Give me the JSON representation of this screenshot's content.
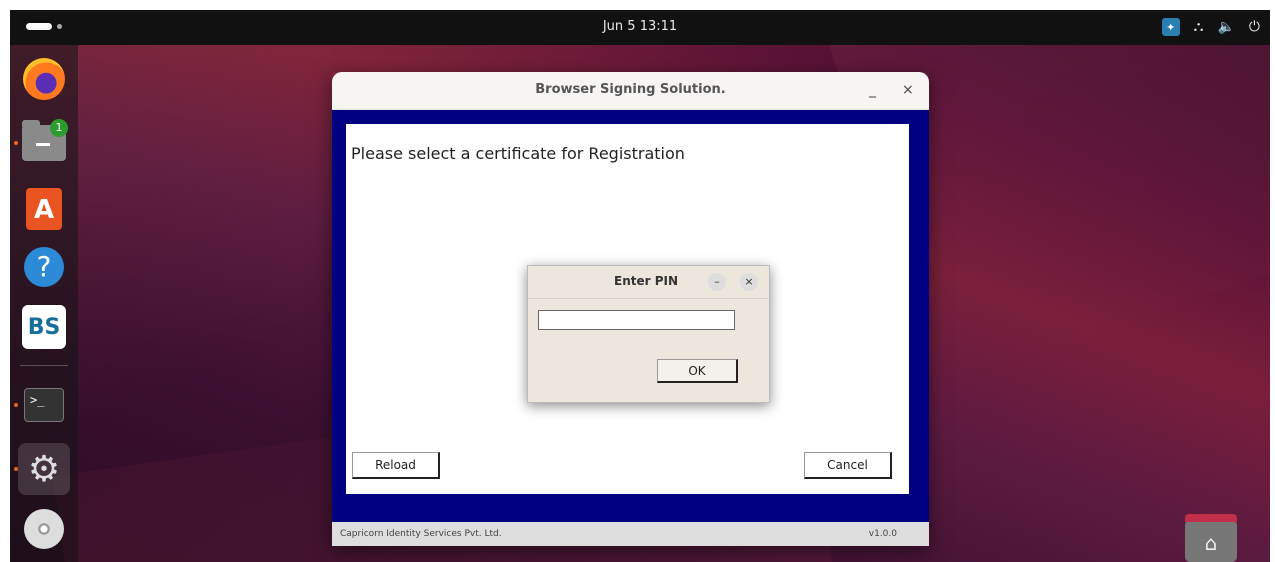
{
  "topbar": {
    "clock": "Jun 5  13:11",
    "tray_icons": [
      "app-indicator-icon",
      "network-icon",
      "volume-icon",
      "power-icon"
    ]
  },
  "dock": {
    "items": [
      {
        "name": "firefox",
        "icon": "firefox-icon"
      },
      {
        "name": "files",
        "icon": "folder-icon",
        "badge": "1"
      },
      {
        "name": "app-center",
        "icon": "store-icon",
        "glyph": "A"
      },
      {
        "name": "help",
        "icon": "help-icon",
        "glyph": "?"
      },
      {
        "name": "browser-signing",
        "icon": "bs-icon",
        "glyph": "BS"
      },
      {
        "name": "terminal",
        "icon": "terminal-icon",
        "glyph": ">_"
      },
      {
        "name": "settings",
        "icon": "gear-icon",
        "glyph": "⚙"
      },
      {
        "name": "disc",
        "icon": "disc-icon"
      }
    ]
  },
  "main_window": {
    "title": "Browser Signing Solution.",
    "minimize": "_",
    "close": "×",
    "prompt": "Please select a certificate for Registration",
    "reload_label": "Reload",
    "cancel_label": "Cancel",
    "company": "Capricorn Identity Services Pvt. Ltd.",
    "version": "v1.0.0",
    "frame_color": "#000080"
  },
  "pin_dialog": {
    "title": "Enter PIN",
    "minimize": "–",
    "close": "×",
    "input_value": "",
    "ok_label": "OK"
  },
  "desktop": {
    "home_icon": "home-folder-icon",
    "home_glyph": "⌂"
  }
}
